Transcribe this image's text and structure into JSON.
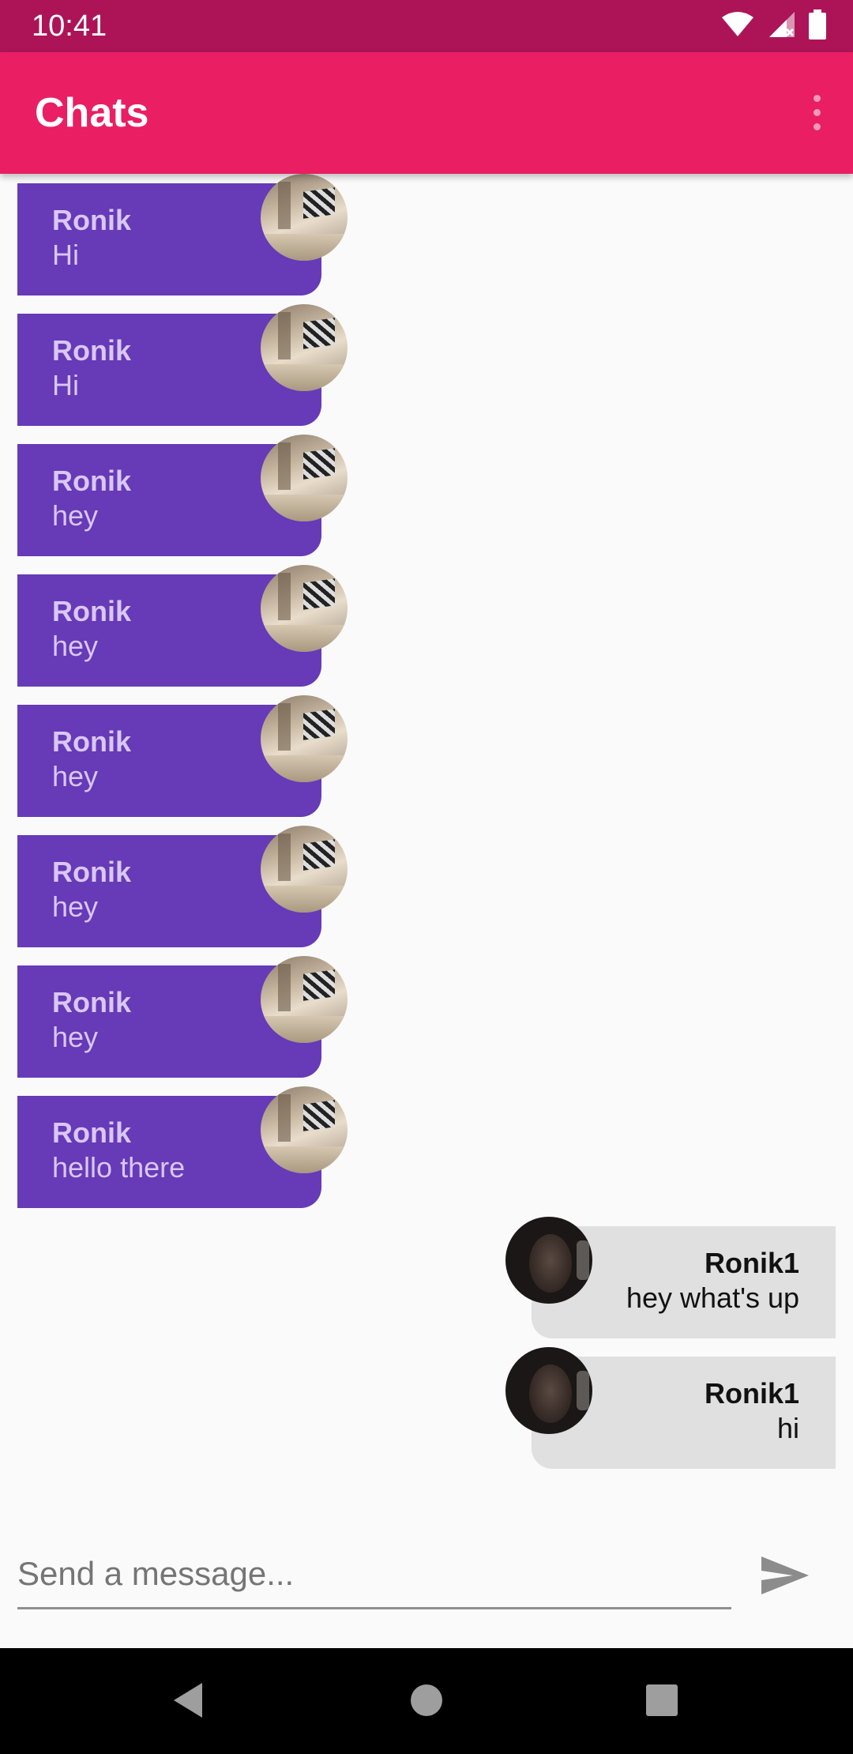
{
  "status_bar": {
    "time": "10:41",
    "icons": [
      "wifi-icon",
      "signal-icon",
      "battery-icon"
    ]
  },
  "app_bar": {
    "title": "Chats",
    "overflow_icon": "more-vert-icon"
  },
  "colors": {
    "status_bar": "#ad1457",
    "app_bar": "#e91e63",
    "incoming_bubble": "#673ab7",
    "outgoing_bubble": "#e0e0e0"
  },
  "messages": [
    {
      "direction": "incoming",
      "name": "Ronik",
      "text": "Hi"
    },
    {
      "direction": "incoming",
      "name": "Ronik",
      "text": "Hi"
    },
    {
      "direction": "incoming",
      "name": "Ronik",
      "text": "hey"
    },
    {
      "direction": "incoming",
      "name": "Ronik",
      "text": "hey"
    },
    {
      "direction": "incoming",
      "name": "Ronik",
      "text": "hey"
    },
    {
      "direction": "incoming",
      "name": "Ronik",
      "text": "hey"
    },
    {
      "direction": "incoming",
      "name": "Ronik",
      "text": "hey"
    },
    {
      "direction": "incoming",
      "name": "Ronik",
      "text": "hello there"
    },
    {
      "direction": "outgoing",
      "name": "Ronik1",
      "text": "hey what's up"
    },
    {
      "direction": "outgoing",
      "name": "Ronik1",
      "text": "hi"
    }
  ],
  "composer": {
    "placeholder": "Send a message...",
    "value": "",
    "send_icon": "send-icon"
  },
  "nav_bar": {
    "icons": [
      "back-icon",
      "home-icon",
      "recents-icon"
    ]
  }
}
